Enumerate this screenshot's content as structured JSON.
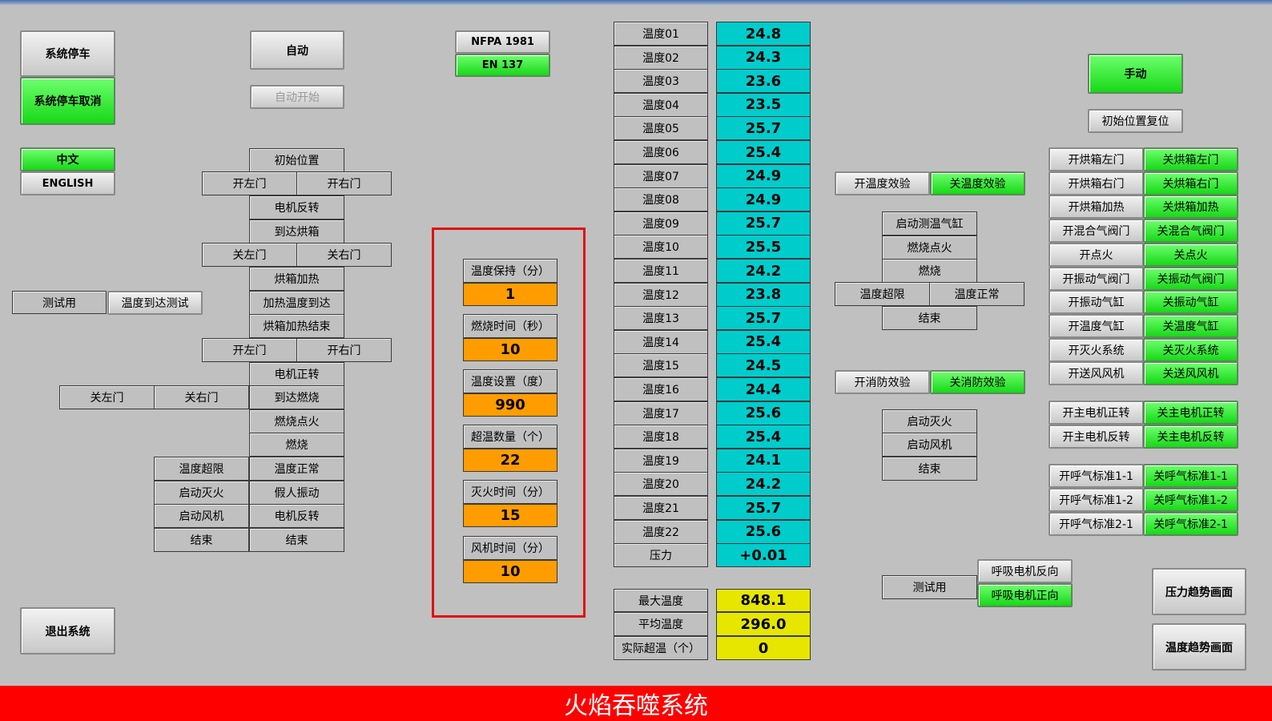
{
  "left": {
    "stop": "系统停车",
    "stop_cancel": "系统停车取消",
    "lang_cn": "中文",
    "lang_en": "ENGLISH",
    "test": "测试用",
    "temp_test": "温度到达测试",
    "exit": "退出系统"
  },
  "auto": {
    "auto": "自动",
    "auto_start": "自动开始"
  },
  "flow": {
    "init_pos": "初始位置",
    "open_left_1": "开左门",
    "open_right_1": "开右门",
    "motor_rev_1": "电机反转",
    "reach_oven": "到达烘箱",
    "close_left_1": "关左门",
    "close_right_1": "关右门",
    "oven_heat": "烘箱加热",
    "heat_reach": "加热温度到达",
    "oven_heat_end": "烘箱加热结束",
    "open_left_2": "开左门",
    "open_right_2": "开右门",
    "motor_fwd": "电机正转",
    "close_left_2": "关左门",
    "close_right_2": "关右门",
    "reach_burn": "到达燃烧",
    "burn_ignite": "燃烧点火",
    "burn": "燃烧",
    "temp_over": "温度超限",
    "temp_normal": "温度正常",
    "start_extinguish": "启动灭火",
    "fake_vibrate": "假人振动",
    "start_fan": "启动风机",
    "motor_rev_2": "电机反转",
    "end_1": "结束",
    "end_2": "结束"
  },
  "standards": {
    "nfpa": "NFPA 1981",
    "en": "EN 137"
  },
  "params": [
    {
      "label": "温度保持（分）",
      "value": "1"
    },
    {
      "label": "燃烧时间（秒）",
      "value": "10"
    },
    {
      "label": "温度设置（度）",
      "value": "990"
    },
    {
      "label": "超温数量（个）",
      "value": "22"
    },
    {
      "label": "灭火时间（分）",
      "value": "15"
    },
    {
      "label": "风机时间（分）",
      "value": "10"
    }
  ],
  "temps": [
    {
      "label": "温度01",
      "value": "24.8"
    },
    {
      "label": "温度02",
      "value": "24.3"
    },
    {
      "label": "温度03",
      "value": "23.6"
    },
    {
      "label": "温度04",
      "value": "23.5"
    },
    {
      "label": "温度05",
      "value": "25.7"
    },
    {
      "label": "温度06",
      "value": "25.4"
    },
    {
      "label": "温度07",
      "value": "24.9"
    },
    {
      "label": "温度08",
      "value": "24.9"
    },
    {
      "label": "温度09",
      "value": "25.7"
    },
    {
      "label": "温度10",
      "value": "25.5"
    },
    {
      "label": "温度11",
      "value": "24.2"
    },
    {
      "label": "温度12",
      "value": "23.8"
    },
    {
      "label": "温度13",
      "value": "25.7"
    },
    {
      "label": "温度14",
      "value": "25.4"
    },
    {
      "label": "温度15",
      "value": "24.5"
    },
    {
      "label": "温度16",
      "value": "24.4"
    },
    {
      "label": "温度17",
      "value": "25.6"
    },
    {
      "label": "温度18",
      "value": "25.4"
    },
    {
      "label": "温度19",
      "value": "24.1"
    },
    {
      "label": "温度20",
      "value": "24.2"
    },
    {
      "label": "温度21",
      "value": "25.7"
    },
    {
      "label": "温度22",
      "value": "25.6"
    },
    {
      "label": "压力",
      "value": "+0.01"
    }
  ],
  "summary": [
    {
      "label": "最大温度",
      "value": "848.1"
    },
    {
      "label": "平均温度",
      "value": "296.0"
    },
    {
      "label": "实际超温（个）",
      "value": "0"
    }
  ],
  "mid": {
    "open_temp_test": "开温度效验",
    "close_temp_test": "关温度效验",
    "start_temp_cyl": "启动测温气缸",
    "burn_ignite": "燃烧点火",
    "burn": "燃烧",
    "temp_over": "温度超限",
    "temp_normal": "温度正常",
    "end_1": "结束",
    "open_fire_test": "开消防效验",
    "close_fire_test": "关消防效验",
    "start_extinguish": "启动灭火",
    "start_fan": "启动风机",
    "end_2": "结束",
    "test": "测试用",
    "breath_rev": "呼吸电机反向",
    "breath_fwd": "呼吸电机正向"
  },
  "right": {
    "manual": "手动",
    "reset": "初始位置复位",
    "pairs": [
      {
        "on": "开烘箱左门",
        "off": "关烘箱左门"
      },
      {
        "on": "开烘箱右门",
        "off": "关烘箱右门"
      },
      {
        "on": "开烘箱加热",
        "off": "关烘箱加热"
      },
      {
        "on": "开混合气阀门",
        "off": "关混合气阀门"
      },
      {
        "on": "开点火",
        "off": "关点火"
      },
      {
        "on": "开振动气阀门",
        "off": "关振动气阀门"
      },
      {
        "on": "开振动气缸",
        "off": "关振动气缸"
      },
      {
        "on": "开温度气缸",
        "off": "关温度气缸"
      },
      {
        "on": "开灭火系统",
        "off": "关灭火系统"
      },
      {
        "on": "开送风风机",
        "off": "关送风风机"
      }
    ],
    "motor_pairs": [
      {
        "on": "开主电机正转",
        "off": "关主电机正转"
      },
      {
        "on": "开主电机反转",
        "off": "关主电机反转"
      }
    ],
    "breath_pairs": [
      {
        "on": "开呼气标准1-1",
        "off": "关呼气标准1-1"
      },
      {
        "on": "开呼气标准1-2",
        "off": "关呼气标准1-2"
      },
      {
        "on": "开呼气标准2-1",
        "off": "关呼气标准2-1"
      }
    ],
    "pressure_trend": "压力趋势画面",
    "temp_trend": "温度趋势画面"
  },
  "title": "火焰吞噬系统",
  "colors": {
    "green": "#1ee61e",
    "cyan": "#00cccc",
    "yellow": "#e6e600",
    "orange": "#ff9d00",
    "banner": "#ff0000"
  }
}
